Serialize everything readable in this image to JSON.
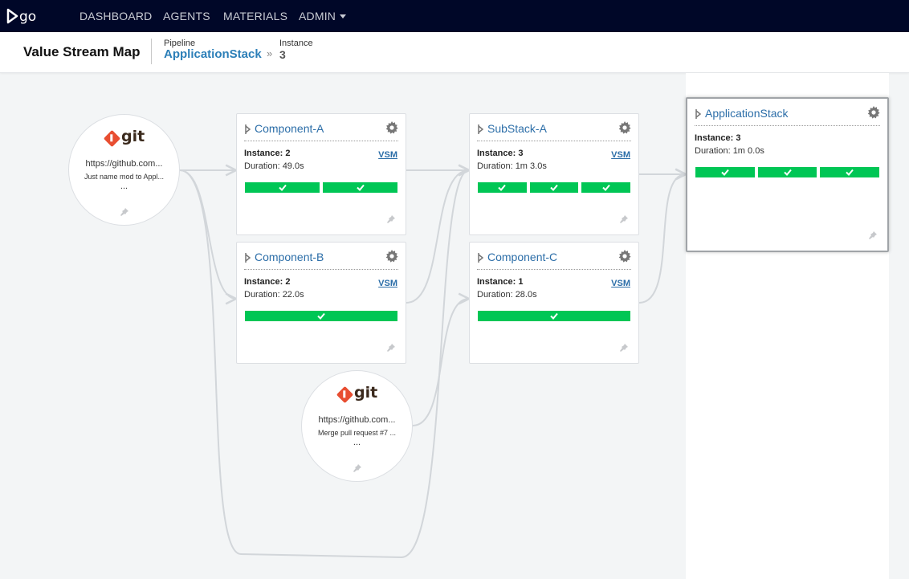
{
  "nav": {
    "items": [
      {
        "label": "DASHBOARD"
      },
      {
        "label": "AGENTS"
      },
      {
        "label": "MATERIALS"
      },
      {
        "label": "ADMIN"
      }
    ]
  },
  "header": {
    "title": "Value Stream Map",
    "pipeline_label": "Pipeline",
    "pipeline_name": "ApplicationStack",
    "separator": "»",
    "instance_label": "Instance",
    "instance_value": "3"
  },
  "colors": {
    "nav_bg": "#000728",
    "link": "#2c6ea8",
    "passed": "#00c655",
    "git": "#e84e31"
  },
  "materials": [
    {
      "type": "git",
      "logo_text": "git",
      "url": "https://github.com...",
      "comment": "Just name mod to Appl...",
      "more": "..."
    },
    {
      "type": "git",
      "logo_text": "git",
      "url": "https://github.com...",
      "comment": "Merge pull request #7 ...",
      "more": "..."
    }
  ],
  "pipelines": [
    {
      "name": "Component-A",
      "instance": "Instance: 2",
      "duration": "Duration: 49.0s",
      "vsm": "VSM",
      "stages": [
        "passed",
        "passed"
      ]
    },
    {
      "name": "Component-B",
      "instance": "Instance: 2",
      "duration": "Duration: 22.0s",
      "vsm": "VSM",
      "stages": [
        "passed"
      ]
    },
    {
      "name": "SubStack-A",
      "instance": "Instance: 3",
      "duration": "Duration: 1m 3.0s",
      "vsm": "VSM",
      "stages": [
        "passed",
        "passed",
        "passed"
      ]
    },
    {
      "name": "Component-C",
      "instance": "Instance: 1",
      "duration": "Duration: 28.0s",
      "vsm": "VSM",
      "stages": [
        "passed"
      ]
    },
    {
      "name": "ApplicationStack",
      "instance": "Instance: 3",
      "duration": "Duration: 1m 0.0s",
      "stages": [
        "passed",
        "passed",
        "passed"
      ],
      "current": true
    }
  ]
}
